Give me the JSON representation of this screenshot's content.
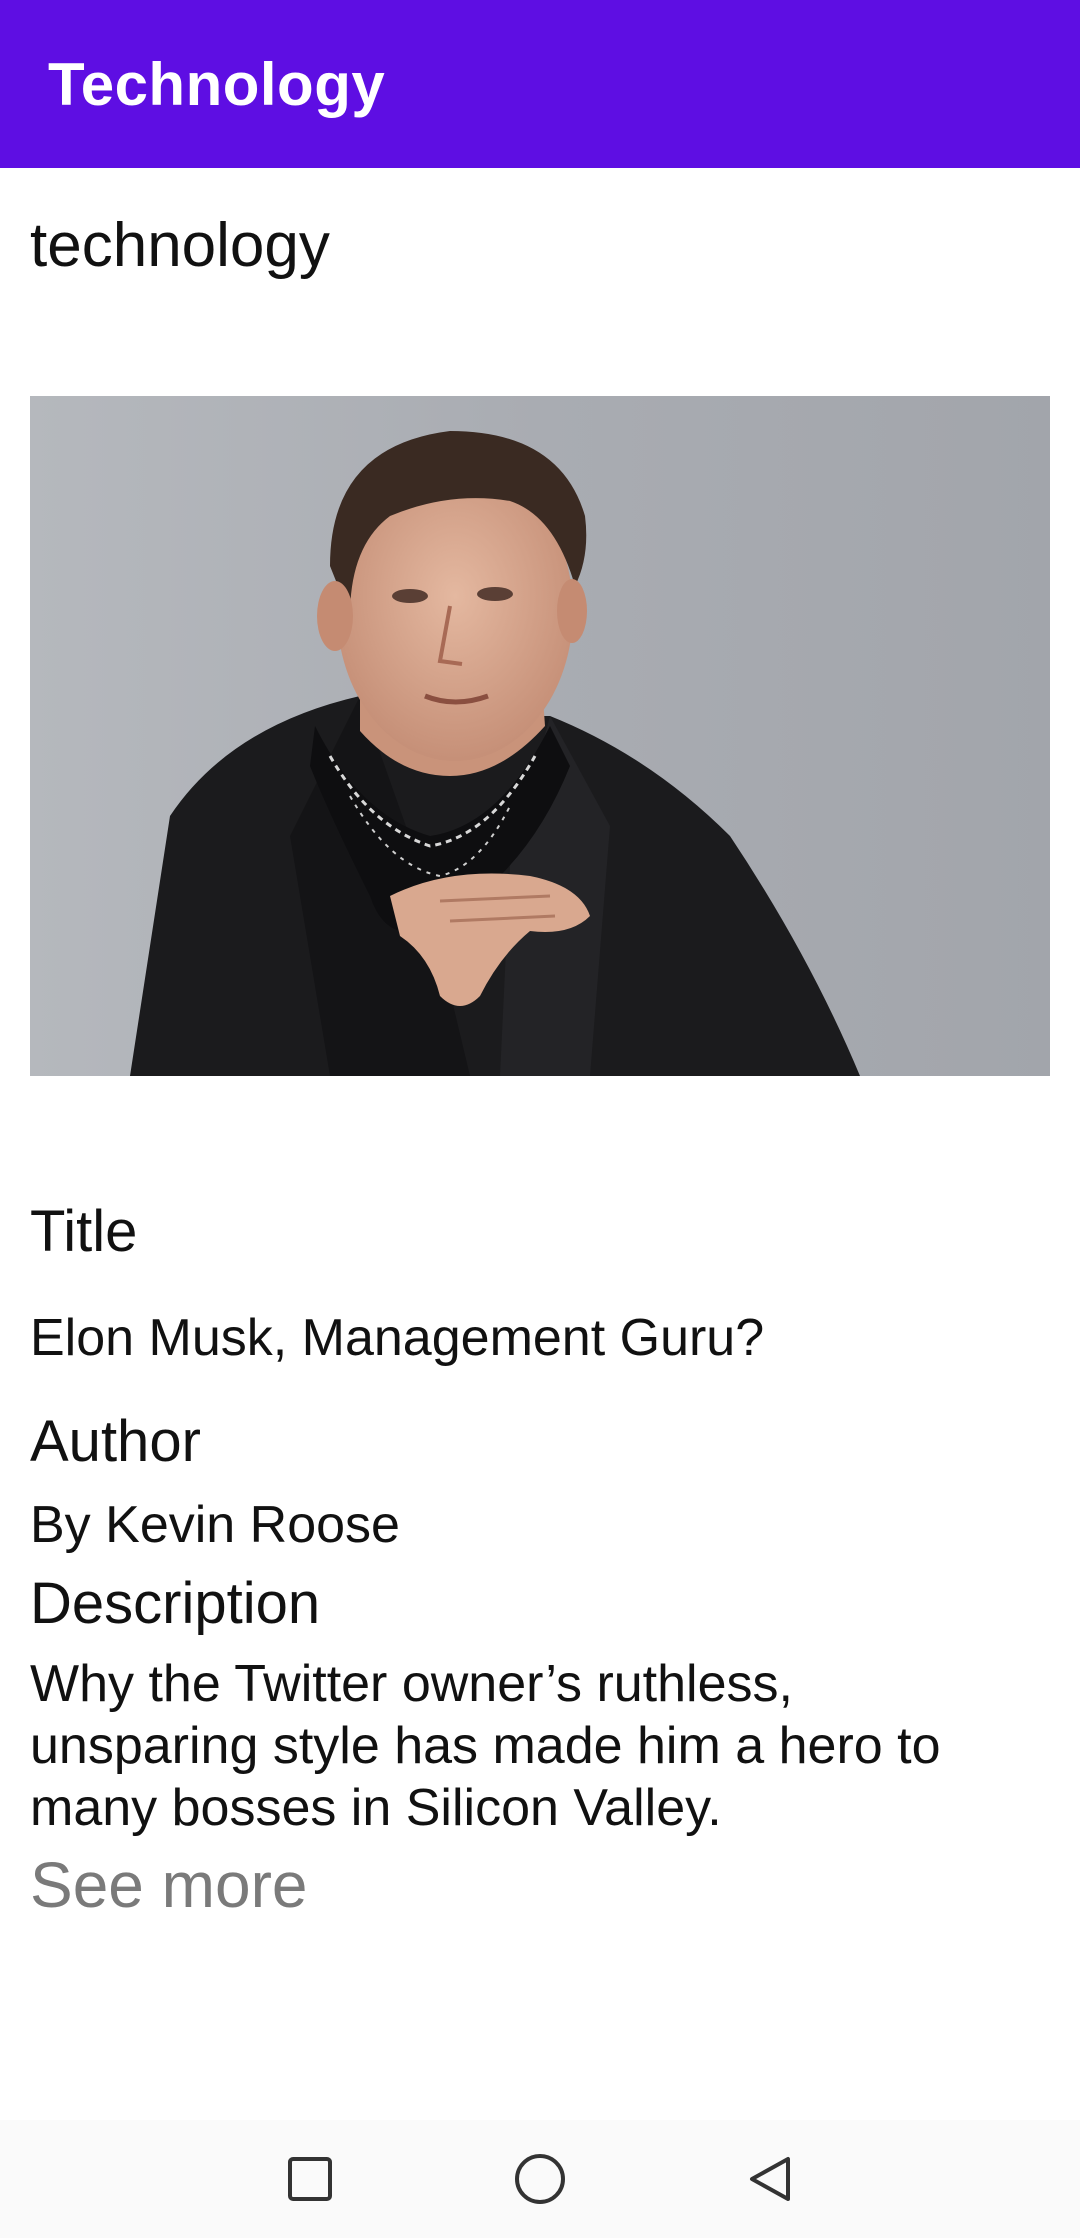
{
  "app_bar": {
    "title": "Technology"
  },
  "article": {
    "category": "technology",
    "title_label": "Title",
    "title": "Elon Musk, Management Guru?",
    "author_label": "Author",
    "author": "By Kevin Roose",
    "description_label": "Description",
    "description": "Why the Twitter owner’s ruthless, unsparing style has made him a hero to many bosses in Silicon Valley.",
    "see_more_label": "See more"
  },
  "nav": {
    "items": [
      "recents-icon",
      "home-icon",
      "back-icon"
    ]
  },
  "colors": {
    "app_bar": "#5e0ee3",
    "see_more": "#7a7a7a"
  }
}
